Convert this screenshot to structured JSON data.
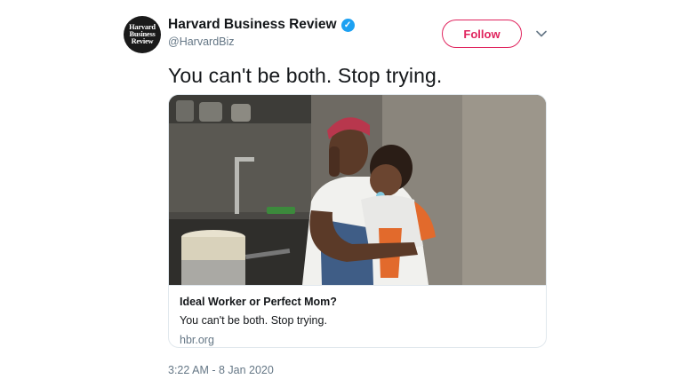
{
  "author": {
    "display_name": "Harvard Business Review",
    "handle": "@HarvardBiz",
    "verified": true,
    "avatar_lines": [
      "Harvard",
      "Business",
      "Review"
    ]
  },
  "actions": {
    "follow_label": "Follow",
    "menu_icon": "chevron-down-icon"
  },
  "tweet": {
    "text": "You can't be both. Stop trying.",
    "timestamp": "3:22 AM - 8 Jan 2020"
  },
  "card": {
    "image_description": "photo-mother-on-phone-holding-baby-in-kitchen",
    "title": "Ideal Worker or Perfect Mom?",
    "description": "You can't be both. Stop trying.",
    "domain": "hbr.org"
  },
  "colors": {
    "follow_accent": "#e0245e",
    "verified_badge": "#1da1f2",
    "secondary_text": "#657786",
    "border": "#e1e8ed"
  }
}
